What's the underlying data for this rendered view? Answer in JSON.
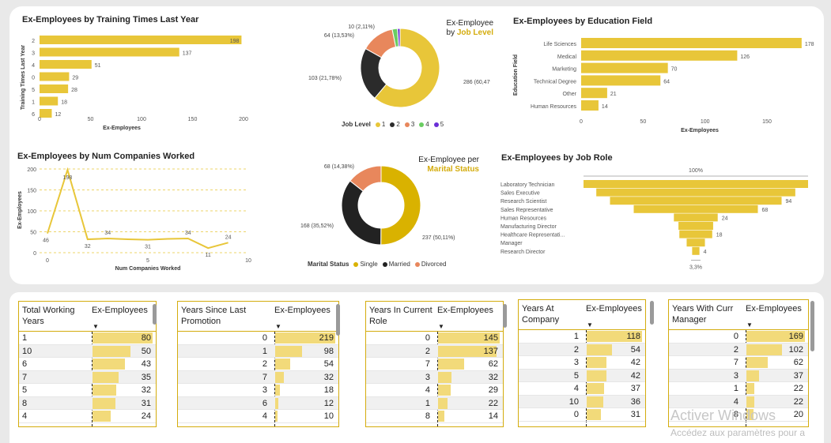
{
  "charts": {
    "training": {
      "title": "Ex-Employees by Training Times Last Year",
      "ylabel": "Training Times Last Year",
      "xlabel": "Ex-Employees",
      "ticks": [
        "0",
        "50",
        "100",
        "150",
        "200"
      ]
    },
    "joblevel": {
      "title_line1": "Ex-Employee",
      "title_by": "by",
      "title_hl": "Job Level",
      "legend_title": "Job Level",
      "legend": [
        "1",
        "2",
        "3",
        "4",
        "5"
      ]
    },
    "education": {
      "title": "Ex-Employees by Education Field",
      "ylabel": "Education Field",
      "xlabel": "Ex-Employees",
      "ticks": [
        "0",
        "50",
        "100",
        "150"
      ]
    },
    "numcomp": {
      "title": "Ex-Employees by Num Companies Worked",
      "ylabel": "Ex-Employees",
      "xlabel": "Num Companies Worked",
      "yticks": [
        "200",
        "150",
        "100",
        "50",
        "0"
      ],
      "xticks": [
        "0",
        "5",
        "10"
      ]
    },
    "marital": {
      "title_line1": "Ex-Employee per",
      "title_hl": "Marital Status",
      "legend_title": "Marital Status",
      "legend": [
        "Single",
        "Married",
        "Divorced"
      ]
    },
    "jobrole": {
      "title": "Ex-Employees by Job Role",
      "top_pct": "100%",
      "bottom_pct": "3,3%"
    }
  },
  "chart_data": [
    {
      "type": "bar",
      "title": "Ex-Employees by Training Times Last Year",
      "categories": [
        "2",
        "3",
        "4",
        "0",
        "5",
        "1",
        "6"
      ],
      "values": [
        198,
        137,
        51,
        29,
        28,
        18,
        12
      ],
      "xlabel": "Ex-Employees",
      "ylabel": "Training Times Last Year",
      "xlim": [
        0,
        200
      ]
    },
    {
      "type": "pie",
      "title": "Ex-Employee by Job Level",
      "categories": [
        "1",
        "2",
        "3",
        "4",
        "5"
      ],
      "values": [
        286,
        103,
        64,
        10,
        5
      ],
      "labels": [
        "286 (60,47%)",
        "103 (21,78%)",
        "64 (13,53%)",
        "10 (2,11%)",
        ""
      ],
      "colors": [
        "#E8C639",
        "#2b2b2b",
        "#E8875C",
        "#6ACD62",
        "#6A2FD6"
      ]
    },
    {
      "type": "bar",
      "title": "Ex-Employees by Education Field",
      "categories": [
        "Life Sciences",
        "Medical",
        "Marketing",
        "Technical Degree",
        "Other",
        "Human Resources"
      ],
      "values": [
        178,
        126,
        70,
        64,
        21,
        14
      ],
      "xlabel": "Ex-Employees",
      "ylabel": "Education Field",
      "xlim": [
        0,
        180
      ]
    },
    {
      "type": "line",
      "title": "Ex-Employees by Num Companies Worked",
      "x": [
        0,
        1,
        2,
        3,
        4,
        5,
        6,
        7,
        8,
        9
      ],
      "values": [
        46,
        198,
        32,
        34,
        32,
        31,
        33,
        34,
        11,
        24
      ],
      "point_labels": [
        "46",
        "198",
        "32",
        "34",
        "",
        "31",
        "",
        "34",
        "11",
        "24"
      ],
      "xlabel": "Num Companies Worked",
      "ylabel": "Ex-Employees",
      "ylim": [
        0,
        200
      ],
      "xlim": [
        0,
        10
      ]
    },
    {
      "type": "pie",
      "title": "Ex-Employee per Marital Status",
      "categories": [
        "Single",
        "Married",
        "Divorced"
      ],
      "values": [
        237,
        168,
        68
      ],
      "labels": [
        "237 (50,11%)",
        "168 (35,52%)",
        "68 (14,38%)"
      ],
      "colors": [
        "#D9B200",
        "#222222",
        "#E8875C"
      ]
    },
    {
      "type": "bar",
      "subtype": "funnel",
      "title": "Ex-Employees by Job Role",
      "categories": [
        "Laboratory Technician",
        "Sales Executive",
        "Research Scientist",
        "Sales Representative",
        "Human Resources",
        "Manufacturing Director",
        "Healthcare Representati...",
        "Manager",
        "Research Director"
      ],
      "values": [
        123,
        109,
        94,
        68,
        24,
        19,
        18,
        10,
        4
      ],
      "value_labels": [
        "",
        "",
        "94",
        "68",
        "24",
        "",
        "18",
        "",
        "4"
      ]
    }
  ],
  "tables": [
    {
      "h1": "Total Working\nYears",
      "h2": "Ex-Employees",
      "rows": [
        [
          "1",
          "80"
        ],
        [
          "10",
          "50"
        ],
        [
          "6",
          "43"
        ],
        [
          "7",
          "35"
        ],
        [
          "5",
          "32"
        ],
        [
          "8",
          "31"
        ],
        [
          "4",
          "24"
        ]
      ],
      "max": 80
    },
    {
      "h1": "Years Since Last\nPromotion",
      "h2": "Ex-Employees",
      "rows": [
        [
          "0",
          "219"
        ],
        [
          "1",
          "98"
        ],
        [
          "2",
          "54"
        ],
        [
          "7",
          "32"
        ],
        [
          "3",
          "18"
        ],
        [
          "6",
          "12"
        ],
        [
          "4",
          "10"
        ]
      ],
      "max": 219
    },
    {
      "h1": "Years In Current\nRole",
      "h2": "Ex-Employees",
      "rows": [
        [
          "0",
          "145"
        ],
        [
          "2",
          "137"
        ],
        [
          "7",
          "62"
        ],
        [
          "3",
          "32"
        ],
        [
          "4",
          "29"
        ],
        [
          "1",
          "22"
        ],
        [
          "8",
          "14"
        ]
      ],
      "max": 145
    },
    {
      "h1": "Years At\nCompany",
      "h2": "Ex-Employees",
      "rows": [
        [
          "1",
          "118"
        ],
        [
          "2",
          "54"
        ],
        [
          "3",
          "42"
        ],
        [
          "5",
          "42"
        ],
        [
          "4",
          "37"
        ],
        [
          "10",
          "36"
        ],
        [
          "0",
          "31"
        ]
      ],
      "max": 118
    },
    {
      "h1": "Years With Curr\nManager",
      "h2": "Ex-Employees",
      "rows": [
        [
          "0",
          "169"
        ],
        [
          "2",
          "102"
        ],
        [
          "7",
          "62"
        ],
        [
          "3",
          "37"
        ],
        [
          "1",
          "22"
        ],
        [
          "4",
          "22"
        ],
        [
          "8",
          "20"
        ]
      ],
      "max": 169
    }
  ],
  "watermark": {
    "line1": "Activer Windows",
    "line2": "Accédez aux paramètres pour a"
  }
}
